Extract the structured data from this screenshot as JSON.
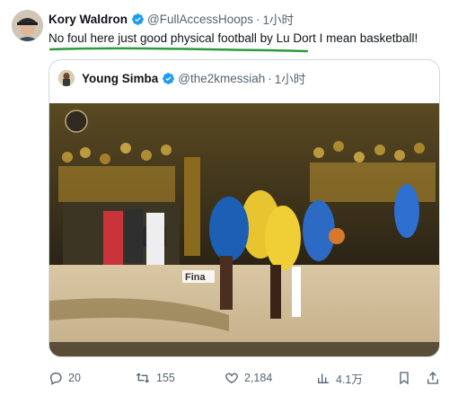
{
  "tweet": {
    "author_name": "Kory Waldron",
    "author_handle": "@FullAccessHoops",
    "separator": "·",
    "time": "1小时",
    "text": "No foul here just good physical football by Lu Dort I mean basketball!"
  },
  "quoted_tweet": {
    "author_name": "Young Simba",
    "author_handle": "@the2kmessiah",
    "separator": "·",
    "time": "1小时",
    "media_watermark": "Fina"
  },
  "actions": {
    "replies": "20",
    "retweets": "155",
    "likes": "2,184",
    "views": "4.1万"
  },
  "icons": {
    "verified": "verified-badge-icon",
    "reply": "reply-icon",
    "retweet": "retweet-icon",
    "like": "heart-icon",
    "views": "views-chart-icon",
    "bookmark": "bookmark-icon",
    "share": "share-icon"
  },
  "colors": {
    "verified_blue": "#1d9bf0",
    "secondary_text": "#536471",
    "highlight_underline": "#2e9a3c"
  }
}
